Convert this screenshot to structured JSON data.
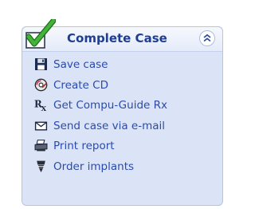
{
  "panel": {
    "title": "Complete Case",
    "items": [
      {
        "label": "Save case",
        "icon": "floppy-disk-icon"
      },
      {
        "label": "Create CD",
        "icon": "cd-disc-icon"
      },
      {
        "label": "Get Compu-Guide Rx",
        "icon": "prescription-rx-icon"
      },
      {
        "label": "Send case via e-mail",
        "icon": "envelope-icon"
      },
      {
        "label": "Print report",
        "icon": "printer-icon"
      },
      {
        "label": "Order implants",
        "icon": "implant-icon"
      }
    ]
  },
  "colors": {
    "panel_bg": "#dbe4f7",
    "title": "#1f3d93",
    "link": "#2b4bab",
    "check": "#3aa035"
  }
}
